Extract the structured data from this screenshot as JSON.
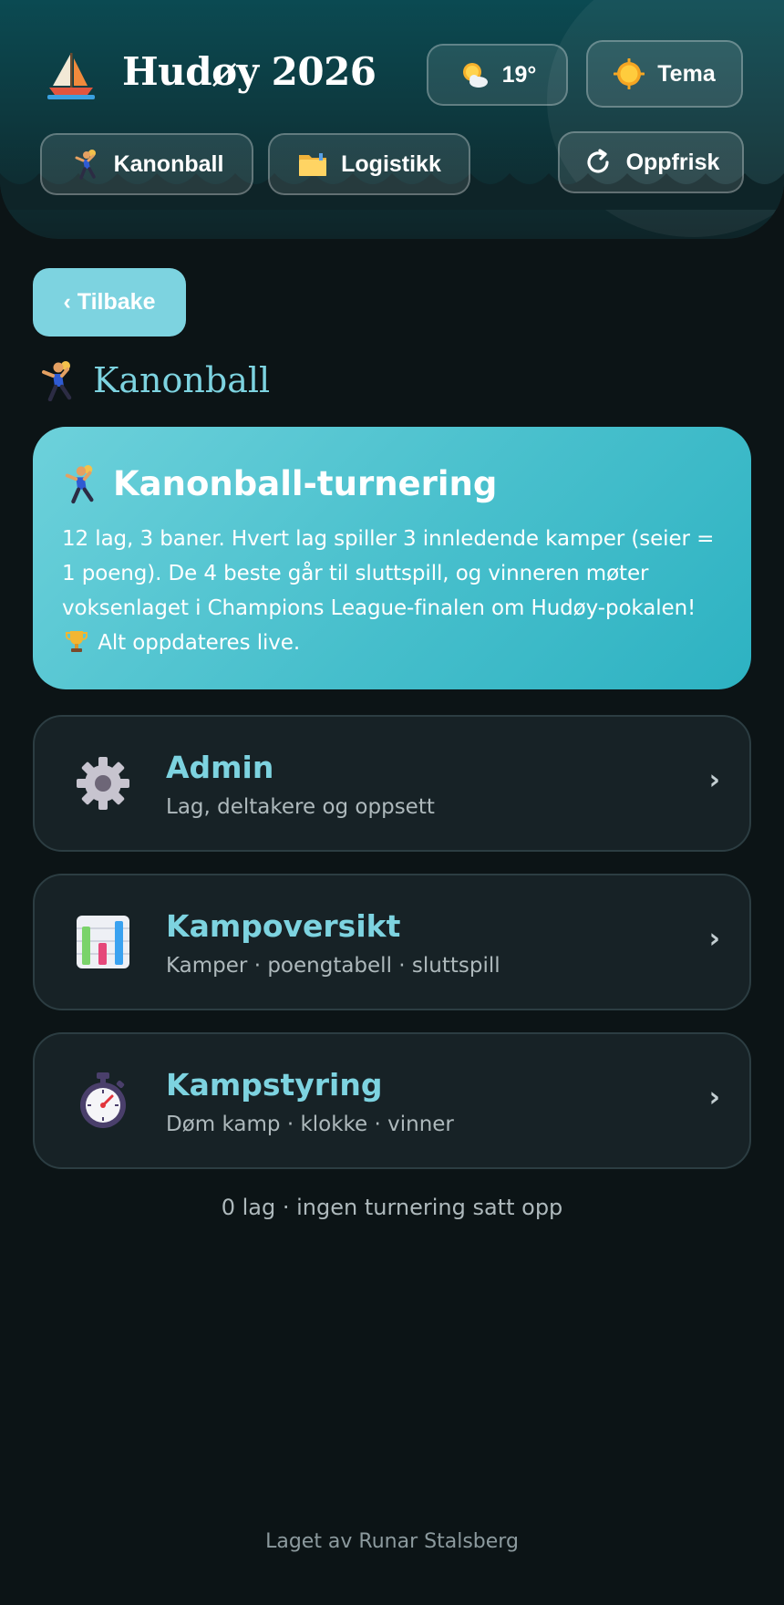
{
  "header": {
    "app_title": "Hudøy 2026",
    "weather": {
      "temp": "19°",
      "icon": "sun-behind-cloud-icon"
    },
    "theme_label": "Tema",
    "nav": [
      {
        "label": "Kanonball",
        "icon": "handball-player-icon"
      },
      {
        "label": "Logistikk",
        "icon": "folder-icon"
      }
    ],
    "refresh_label": "Oppfrisk"
  },
  "back_label": "‹ Tilbake",
  "page_title": "Kanonball",
  "hero": {
    "title": "Kanonball-turnering",
    "desc_part1": "12 lag, 3 baner. Hvert lag spiller 3 innledende kamper (seier = 1 poeng). De 4 beste går til sluttspill, og vinneren møter voksenlaget i Champions League-finalen om Hudøy-pokalen!",
    "desc_part2": "Alt oppdateres live."
  },
  "menu": [
    {
      "title": "Admin",
      "subtitle": "Lag, deltakere og oppsett",
      "icon": "gear-icon"
    },
    {
      "title": "Kampoversikt",
      "subtitle": "Kamper · poengtabell · sluttspill",
      "icon": "bar-chart-icon"
    },
    {
      "title": "Kampstyring",
      "subtitle": "Døm kamp · klokke · vinner",
      "icon": "stopwatch-icon"
    }
  ],
  "status": "0 lag · ingen turnering satt opp",
  "footer": "Laget av Runar Stalsberg",
  "colors": {
    "accent": "#7dd3e0",
    "hero_bg": "#47bfcc",
    "page_bg": "#0c1416",
    "card_bg": "#172226"
  }
}
